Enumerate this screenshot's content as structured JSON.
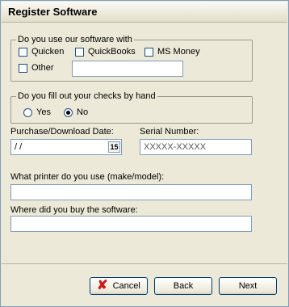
{
  "window": {
    "title": "Register Software"
  },
  "software_group": {
    "legend": "Do you use our software with",
    "options": [
      {
        "label": "Quicken",
        "checked": false
      },
      {
        "label": "QuickBooks",
        "checked": false
      },
      {
        "label": "MS Money",
        "checked": false
      },
      {
        "label": "Other",
        "checked": false
      }
    ],
    "other_value": ""
  },
  "checks_group": {
    "legend": "Do you fill out your checks by hand",
    "options": [
      {
        "label": "Yes",
        "selected": false
      },
      {
        "label": "No",
        "selected": true
      }
    ]
  },
  "fields": {
    "purchase_date_label": "Purchase/Download Date:",
    "purchase_date_value": " / /",
    "calendar_glyph": "15",
    "serial_label": "Serial Number:",
    "serial_value": "XXXXX-XXXXX",
    "printer_label": "What printer do you use (make/model):",
    "printer_value": "",
    "where_label": "Where did you buy the software:",
    "where_value": ""
  },
  "buttons": {
    "cancel": "Cancel",
    "back": "Back",
    "next": "Next"
  }
}
